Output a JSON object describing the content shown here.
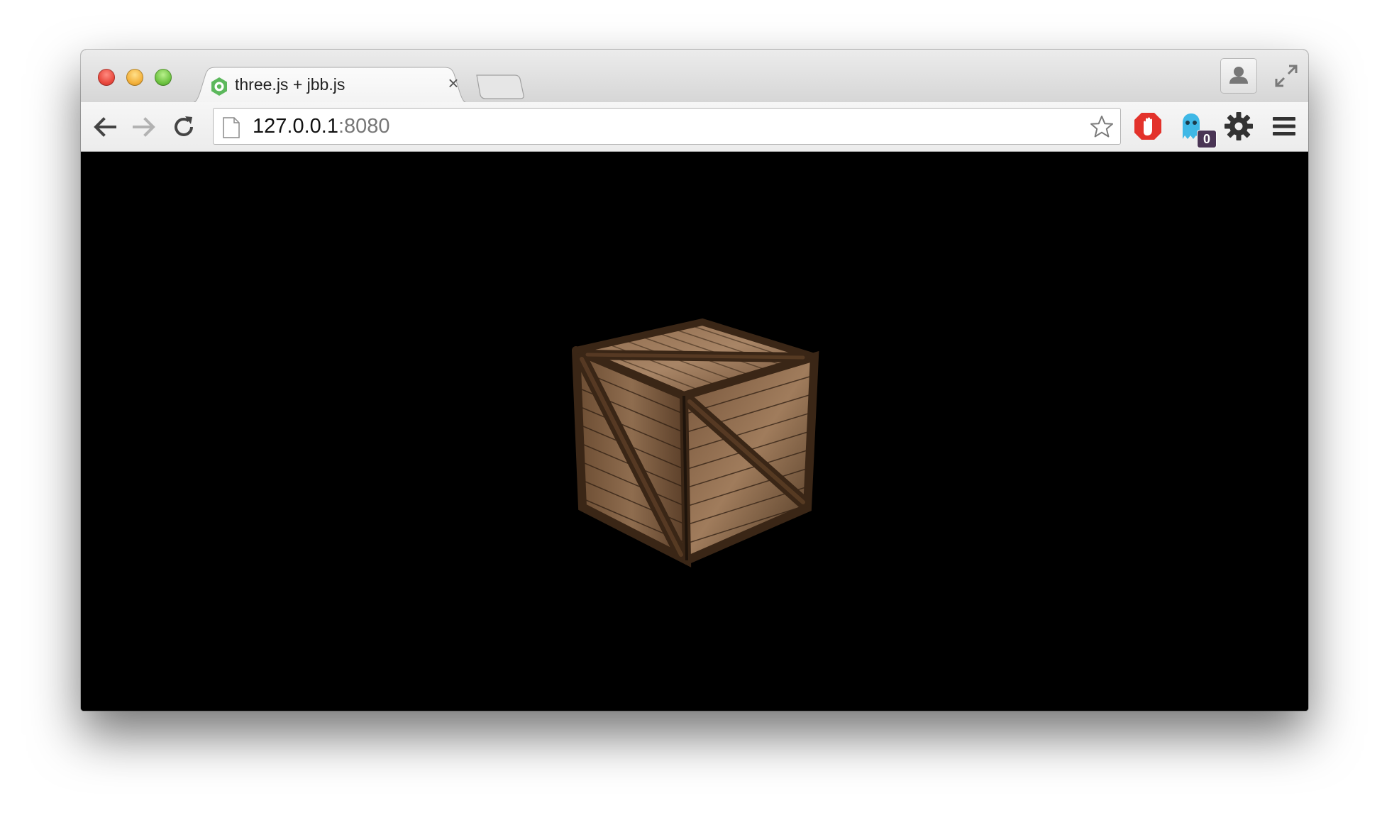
{
  "window": {
    "controls": [
      "close",
      "minimize",
      "zoom"
    ]
  },
  "tabs": [
    {
      "title": "three.js + jbb.js",
      "active": true,
      "favicon": "green-ring-icon",
      "close_label": "×"
    }
  ],
  "toolbar": {
    "back_icon": "back-arrow-icon",
    "forward_icon": "forward-arrow-icon",
    "reload_icon": "reload-icon",
    "address": {
      "host": "127.0.0.1",
      "port": ":8080"
    },
    "bookmark_icon": "star-icon",
    "extensions": [
      {
        "name": "adblock",
        "icon": "stop-hand-icon",
        "color": "#e3322b"
      },
      {
        "name": "ghostery",
        "icon": "ghost-icon",
        "color": "#3fb8e6",
        "badge": "0"
      },
      {
        "name": "settings",
        "icon": "gear-icon",
        "color": "#333333"
      }
    ],
    "menu_icon": "hamburger-menu-icon"
  },
  "content": {
    "background": "#000000",
    "scene": "wooden-crate"
  },
  "colors": {
    "titlebar": "#dcdcdc",
    "favicon": "#5cb85c",
    "wood_light": "#a07c5c",
    "wood_dark": "#4a3420"
  }
}
